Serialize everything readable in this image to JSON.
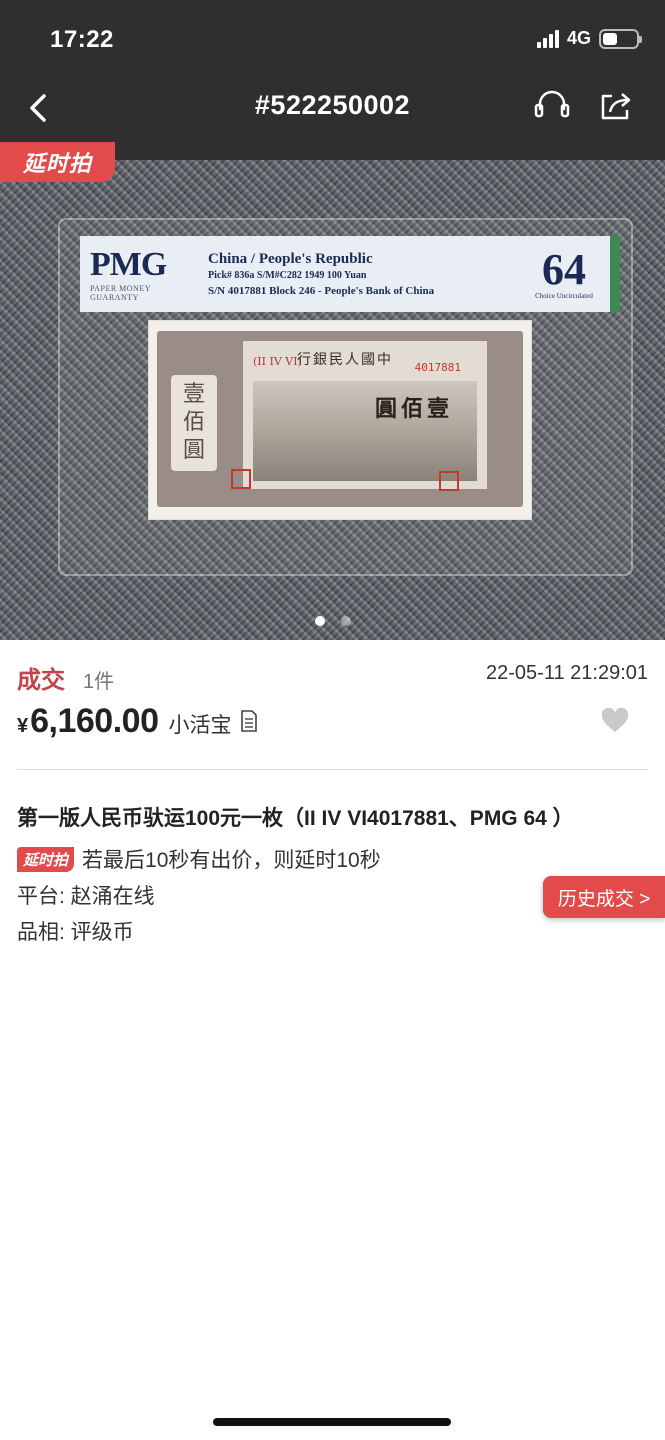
{
  "status_bar": {
    "time": "17:22",
    "network": "4G"
  },
  "header": {
    "title": "#522250002"
  },
  "hero": {
    "badge": "延时拍",
    "slab_label": {
      "brand": "PMG",
      "brand_sub": "PAPER MONEY GUARANTY",
      "line1": "China / People's Republic",
      "line2": "Pick# 836a  S/M#C282  1949  100 Yuan",
      "line3": "S/N 4017881 Block 246 - People's Bank of China",
      "grade": "64",
      "grade_desc": "Choice Uncirculated"
    },
    "note": {
      "bank": "行銀民人國中",
      "value": "圓佰壹",
      "left_value": [
        "壹",
        "佰",
        "圓"
      ],
      "serial_prefix": "(II IV VI)",
      "serial_number": "4017881"
    },
    "pager": {
      "count": 2,
      "active": 0
    }
  },
  "deal": {
    "status": "成交",
    "count": "1件",
    "datetime": "22-05-11 21:29:01",
    "currency": "¥",
    "price": "6,160.00",
    "seller": "小活宝"
  },
  "item": {
    "title": "第一版人民币驮运100元一枚（II IV VI4017881、PMG 64 ）",
    "rule_badge": "延时拍",
    "rule_text": "若最后10秒有出价，则延时10秒",
    "platform": "平台: 赵涌在线",
    "quality": "品相: 评级币",
    "history_button": "历史成交 >"
  },
  "colors": {
    "accent": "#e34a4a",
    "status_red": "#c0444a",
    "header_bg": "#2f2f2f"
  }
}
